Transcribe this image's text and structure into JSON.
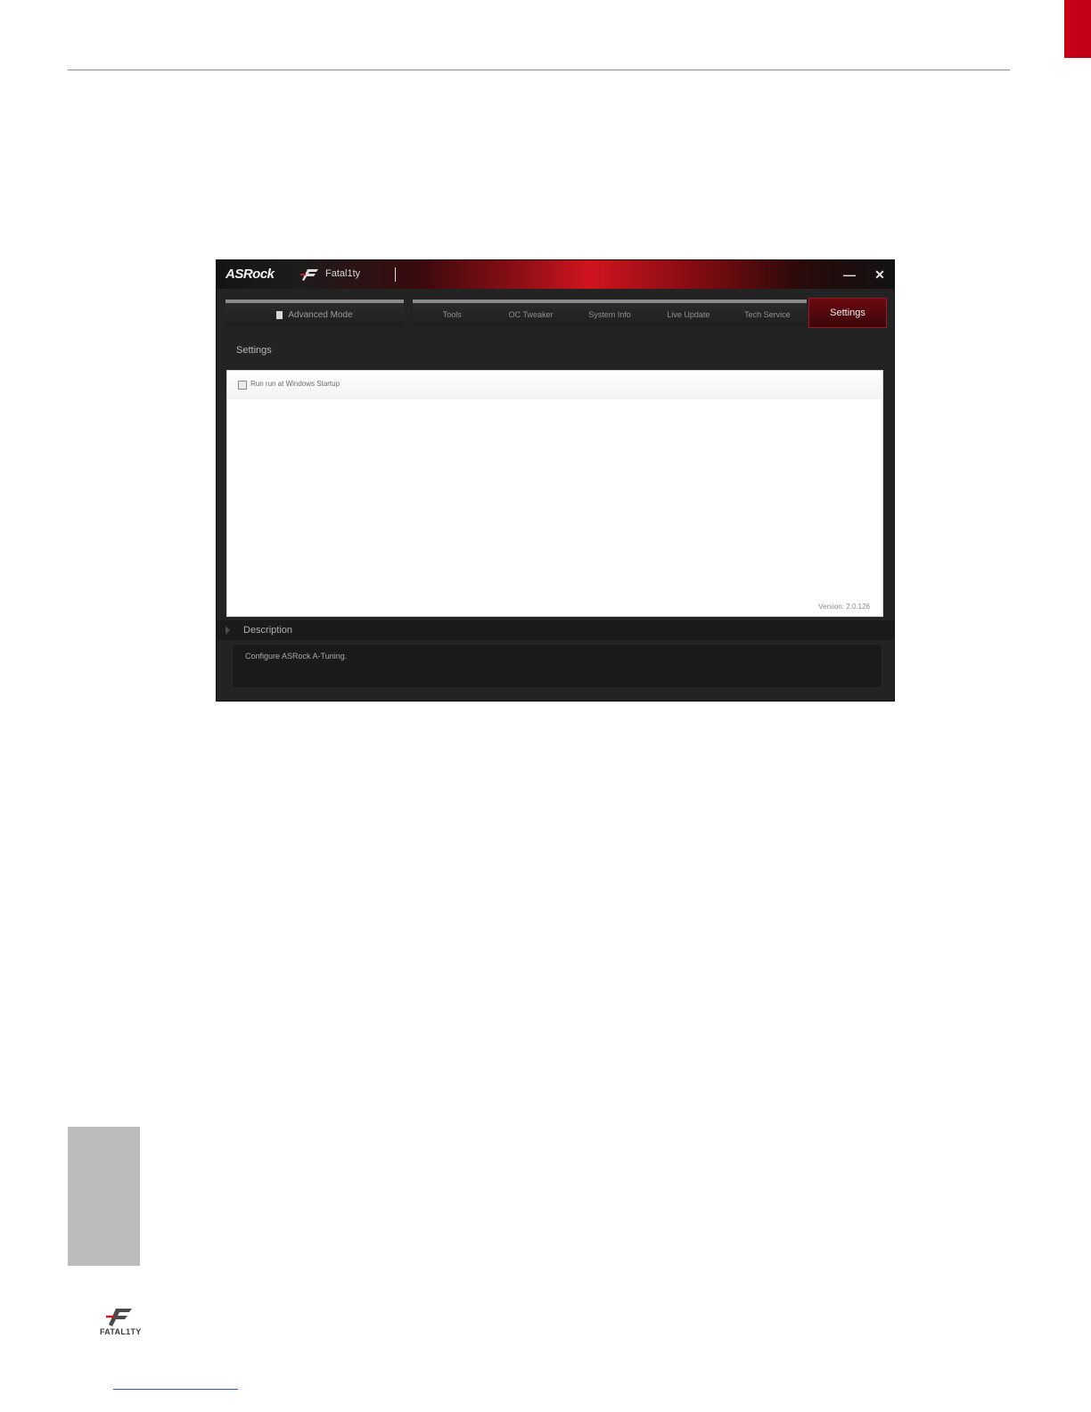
{
  "app": {
    "brand": "ASRock",
    "product_name": "Fatal1ty",
    "module_name": "",
    "minimize_glyph": "—",
    "close_glyph": "✕",
    "mode_button": "Advanced Mode",
    "tabs": [
      "Tools",
      "OC Tweaker",
      "System Info",
      "Live Update",
      "Tech Service"
    ],
    "active_tab": "Settings",
    "section_title": "Settings",
    "checkbox_label": "Run run at Windows Startup",
    "checkbox_checked": false,
    "version": "Version: 2.0.126",
    "description_title": "Description",
    "description_text": "Configure ASRock A-Tuning."
  },
  "footer": {
    "logo_text": "FATAL1TY"
  },
  "colors": {
    "page_tab": "#c40017",
    "side_tab": "#bcbcbd",
    "active_tab": "#6a0a10"
  }
}
